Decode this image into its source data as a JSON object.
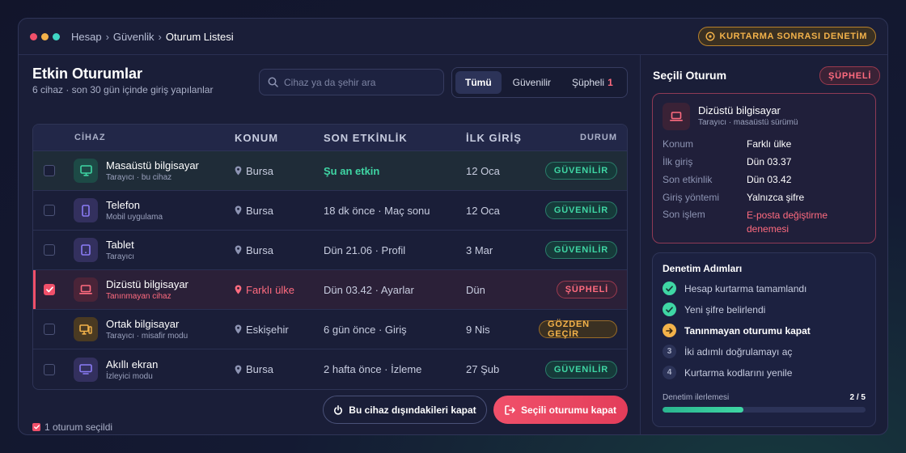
{
  "colors": {
    "accent_green": "#3fd6a4",
    "accent_red": "#f0506a",
    "accent_amber": "#f3b24a",
    "window_bg": "#1a1e38"
  },
  "header": {
    "breadcrumb": [
      "Hesap",
      "Güvenlik",
      "Oturum Listesi"
    ],
    "audit_badge": "KURTARMA SONRASI DENETİM"
  },
  "main": {
    "title": "Etkin Oturumlar",
    "subtitle": "6 cihaz · son 30 gün içinde giriş yapılanlar",
    "search_placeholder": "Cihaz ya da şehir ara",
    "filters": {
      "all": "Tümü",
      "trusted": "Güvenilir",
      "suspect": "Şüpheli",
      "suspect_count": "1"
    },
    "columns": {
      "device": "CİHAZ",
      "location": "KONUM",
      "activity": "SON ETKİNLİK",
      "first_login": "İLK GİRİŞ",
      "status": "DURUM"
    },
    "rows": [
      {
        "name": "Masaüstü bilgisayar",
        "sub": "Tarayıcı · bu cihaz",
        "location": "Bursa",
        "activity": "Şu an etkin",
        "first": "12 Oca",
        "status": "GÜVENİLİR"
      },
      {
        "name": "Telefon",
        "sub": "Mobil uygulama",
        "location": "Bursa",
        "activity": "18 dk önce · Maç sonu",
        "first": "12 Oca",
        "status": "GÜVENİLİR"
      },
      {
        "name": "Tablet",
        "sub": "Tarayıcı",
        "location": "Bursa",
        "activity": "Dün 21.06 · Profil",
        "first": "3 Mar",
        "status": "GÜVENİLİR"
      },
      {
        "name": "Dizüstü bilgisayar",
        "sub": "Tanınmayan cihaz",
        "location": "Farklı ülke",
        "activity": "Dün 03.42 · Ayarlar",
        "first": "Dün",
        "status": "ŞÜPHELİ"
      },
      {
        "name": "Ortak bilgisayar",
        "sub": "Tarayıcı · misafir modu",
        "location": "Eskişehir",
        "activity": "6 gün önce · Giriş",
        "first": "9 Nis",
        "status": "GÖZDEN GEÇİR"
      },
      {
        "name": "Akıllı ekran",
        "sub": "İzleyici modu",
        "location": "Bursa",
        "activity": "2 hafta önce · İzleme",
        "first": "27 Şub",
        "status": "GÜVENİLİR"
      }
    ],
    "selected_count": "1 oturum seçildi",
    "btn_close_others": "Bu cihaz dışındakileri kapat",
    "btn_close_selected": "Seçili oturumu kapat"
  },
  "side": {
    "title": "Seçili Oturum",
    "badge": "ŞÜPHELİ",
    "device_name": "Dizüstü bilgisayar",
    "device_sub": "Tarayıcı · masaüstü sürümü",
    "details": [
      {
        "k": "Konum",
        "v": "Farklı ülke"
      },
      {
        "k": "İlk giriş",
        "v": "Dün 03.37"
      },
      {
        "k": "Son etkinlik",
        "v": "Dün 03.42"
      },
      {
        "k": "Giriş yöntemi",
        "v": "Yalnızca şifre"
      },
      {
        "k": "Son işlem",
        "v": "E-posta değiştirme denemesi"
      }
    ],
    "steps_title": "Denetim Adımları",
    "steps": [
      {
        "label": "Hesap kurtarma tamamlandı",
        "num": ""
      },
      {
        "label": "Yeni şifre belirlendi",
        "num": ""
      },
      {
        "label": "Tanınmayan oturumu kapat",
        "num": ""
      },
      {
        "label": "İki adımlı doğrulamayı aç",
        "num": "3"
      },
      {
        "label": "Kurtarma kodlarını yenile",
        "num": "4"
      }
    ],
    "progress_label": "Denetim ilerlemesi",
    "progress_text": "2 / 5",
    "progress_fraction": 0.4
  }
}
